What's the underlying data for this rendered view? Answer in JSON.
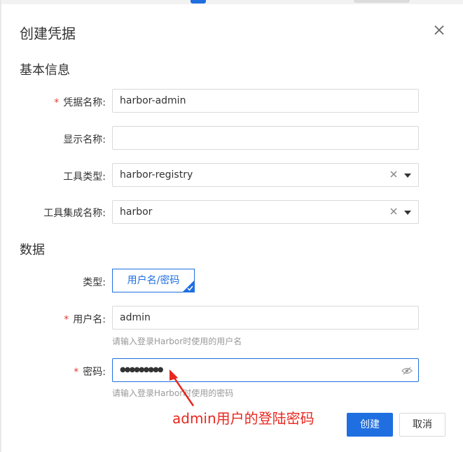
{
  "dialog": {
    "title": "创建凭据"
  },
  "sections": {
    "basic": "基本信息",
    "data": "数据"
  },
  "fields": {
    "credential_name": {
      "label": "凭据名称:",
      "value": "harbor-admin",
      "required": true
    },
    "display_name": {
      "label": "显示名称:",
      "value": ""
    },
    "tool_type": {
      "label": "工具类型:",
      "value": "harbor-registry"
    },
    "tool_integration": {
      "label": "工具集成名称:",
      "value": "harbor"
    },
    "type": {
      "label": "类型:",
      "selected": "用户名/密码"
    },
    "username": {
      "label": "用户名:",
      "value": "admin",
      "hint": "请输入登录Harbor时使用的用户名",
      "required": true
    },
    "password": {
      "label": "密码:",
      "value": "●●●●●●●●●",
      "hint": "请输入登录Harbor时使用的密码",
      "required": true
    }
  },
  "buttons": {
    "create": "创建",
    "cancel": "取消"
  },
  "annotation": "admin用户的登陆密码",
  "required_mark": "*",
  "colors": {
    "primary": "#1f6fe0",
    "required": "#e03c31",
    "annotation": "#e8271e"
  },
  "icons": {
    "close": "close-icon",
    "clear": "clear-icon",
    "dropdown": "chevron-down-icon",
    "check": "check-icon",
    "eye": "eye-off-icon"
  }
}
